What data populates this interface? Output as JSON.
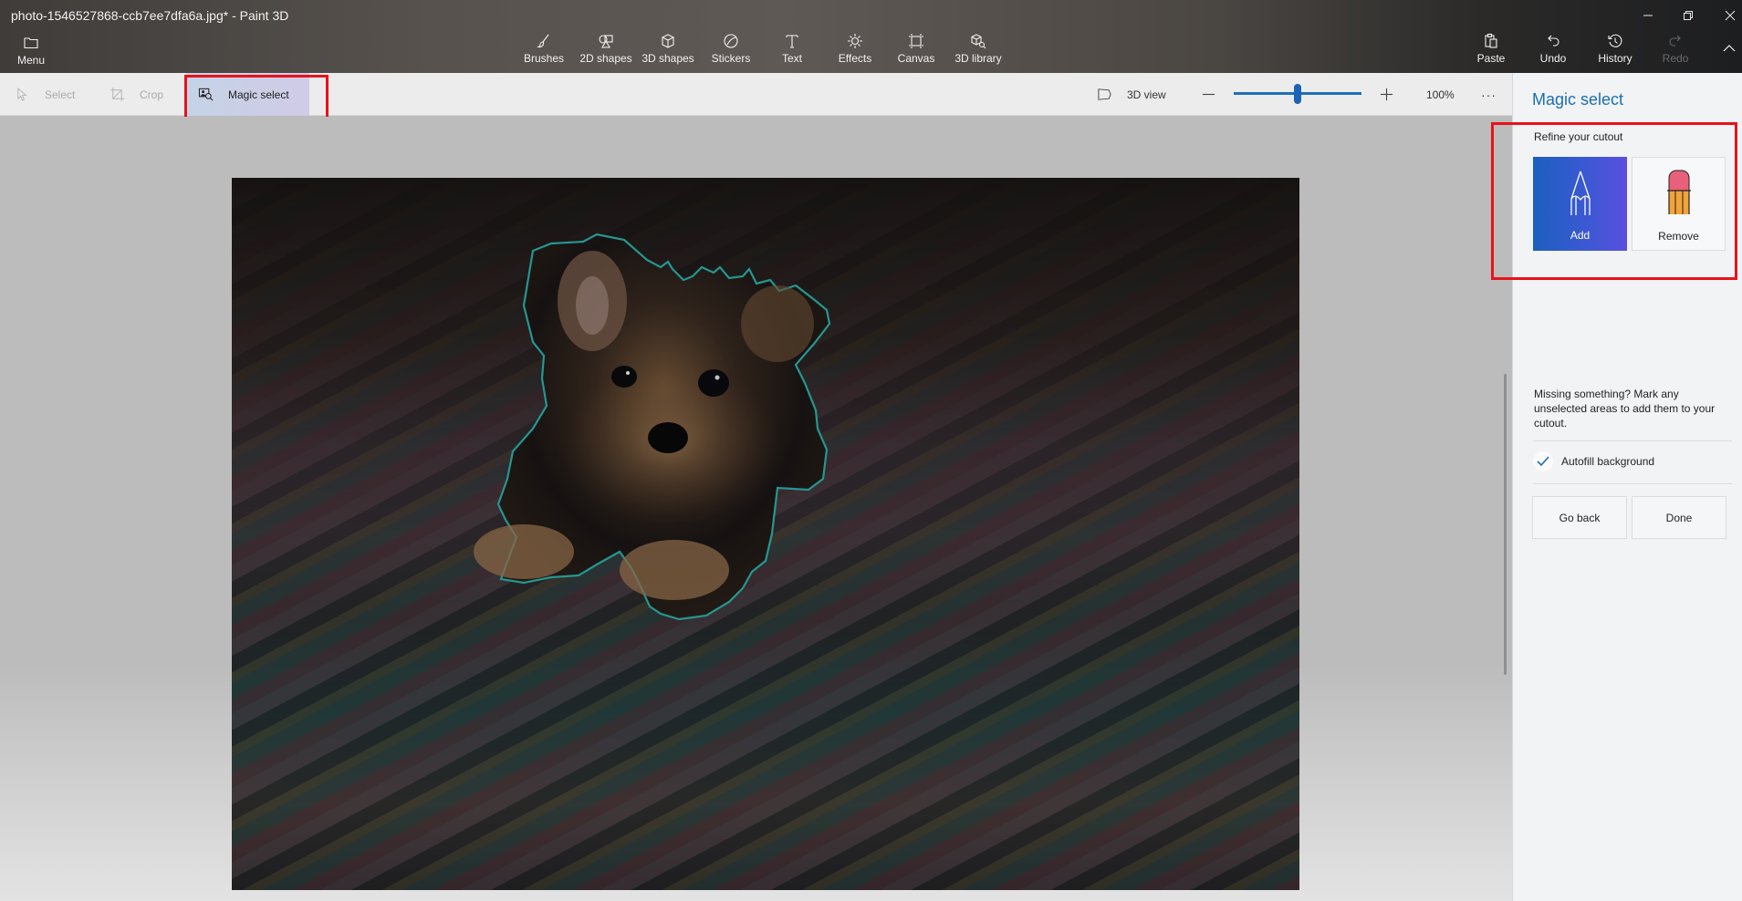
{
  "window": {
    "title": "photo-1546527868-ccb7ee7dfa6a.jpg* - Paint 3D",
    "controls": {
      "minimize": "minimize",
      "restore": "restore",
      "close": "close"
    }
  },
  "header": {
    "menu_label": "Menu",
    "tools": [
      {
        "label": "Brushes",
        "icon": "brush-icon"
      },
      {
        "label": "2D shapes",
        "icon": "2d-shapes-icon"
      },
      {
        "label": "3D shapes",
        "icon": "3d-shapes-icon"
      },
      {
        "label": "Stickers",
        "icon": "stickers-icon"
      },
      {
        "label": "Text",
        "icon": "text-icon"
      },
      {
        "label": "Effects",
        "icon": "effects-icon"
      },
      {
        "label": "Canvas",
        "icon": "canvas-icon"
      },
      {
        "label": "3D library",
        "icon": "3d-library-icon"
      }
    ],
    "actions": [
      {
        "label": "Paste",
        "icon": "paste-icon",
        "enabled": true
      },
      {
        "label": "Undo",
        "icon": "undo-icon",
        "enabled": true
      },
      {
        "label": "History",
        "icon": "history-icon",
        "enabled": true
      },
      {
        "label": "Redo",
        "icon": "redo-icon",
        "enabled": false
      }
    ]
  },
  "subbar": {
    "select_label": "Select",
    "crop_label": "Crop",
    "magic_select_label": "Magic select",
    "view_3d_label": "3D view",
    "zoom_value": "100%",
    "zoom_slider_fraction": 0.5,
    "more_label": "···"
  },
  "panel": {
    "title": "Magic select",
    "refine_label": "Refine your cutout",
    "add_label": "Add",
    "remove_label": "Remove",
    "description": "Missing something? Mark any unselected areas to add them to your cutout.",
    "autofill_label": "Autofill background",
    "autofill_checked": true,
    "go_back_label": "Go back",
    "done_label": "Done"
  },
  "colors": {
    "accent": "#1a6fae",
    "selection_outline": "#2fb8b0",
    "highlight_box": "#e8121c",
    "add_gradient_start": "#1c5fbf",
    "add_gradient_end": "#5a4fde"
  }
}
